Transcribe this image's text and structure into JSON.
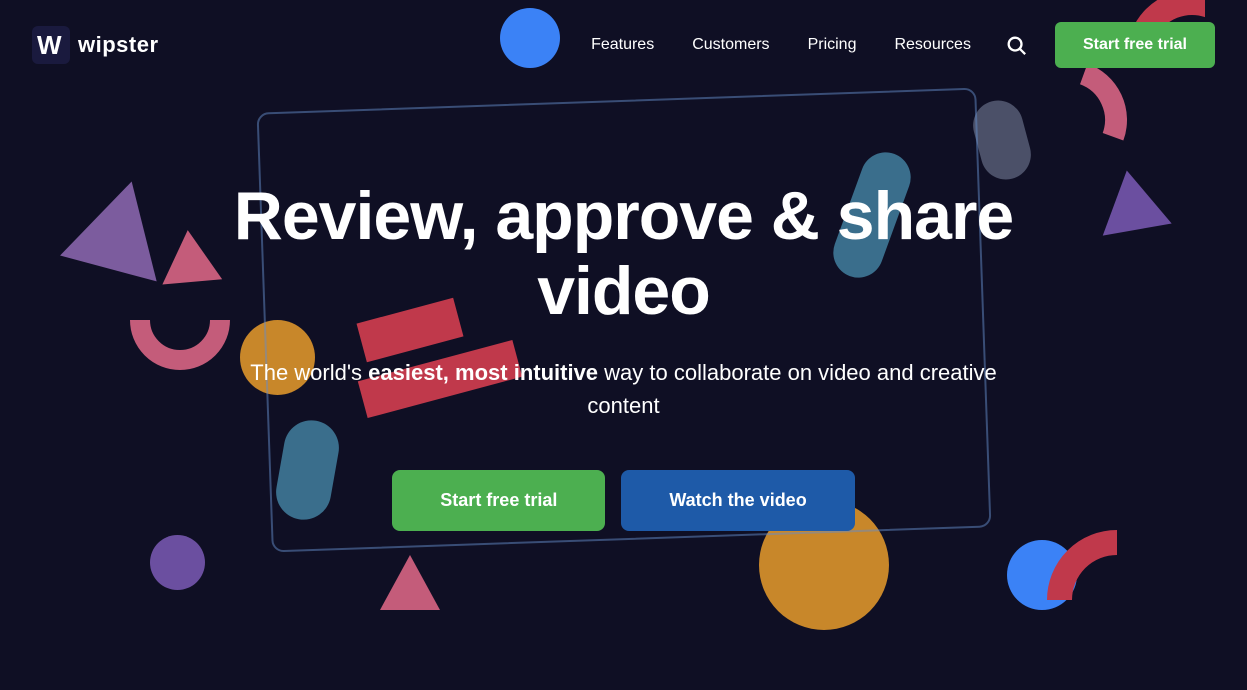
{
  "brand": {
    "logo_letter": "W",
    "name": "wipster"
  },
  "nav": {
    "links": [
      {
        "id": "features",
        "label": "Features"
      },
      {
        "id": "customers",
        "label": "Customers"
      },
      {
        "id": "pricing",
        "label": "Pricing"
      },
      {
        "id": "resources",
        "label": "Resources"
      }
    ],
    "cta_label": "Start free trial"
  },
  "hero": {
    "heading_line1": "Review, approve & share",
    "heading_line2": "video",
    "subtext_prefix": "The world's ",
    "subtext_bold1": "easiest,",
    "subtext_bold2": "most intuitive",
    "subtext_suffix": " way to collaborate on video and creative content",
    "btn_trial_label": "Start free trial",
    "btn_video_label": "Watch the video"
  }
}
